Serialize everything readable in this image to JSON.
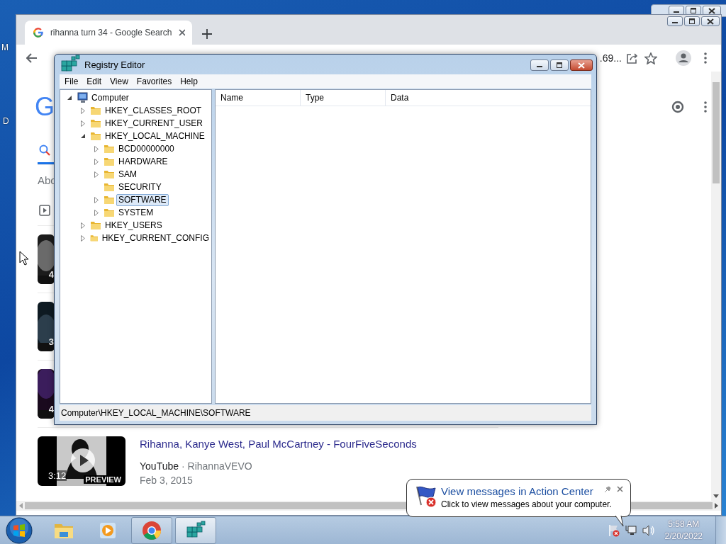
{
  "desktop": {
    "icon_labels": [
      "M",
      "D"
    ]
  },
  "browser": {
    "tab": {
      "title": "rihanna turn 34 - Google Search",
      "selected": true
    },
    "address_fragment": ".69...",
    "page": {
      "logo": "G",
      "about_fragment": "Abo",
      "partial_results": [
        {
          "duration": "4"
        },
        {
          "duration": "3"
        },
        {
          "duration": "4"
        }
      ],
      "result": {
        "duration": "3:12",
        "badge": "PREVIEW",
        "title": "Rihanna, Kanye West, Paul McCartney - FourFiveSeconds",
        "source": "YouTube",
        "channel": "· RihannaVEVO",
        "date": "Feb 3, 2015"
      }
    }
  },
  "registry_editor": {
    "title": "Registry Editor",
    "menu": [
      "File",
      "Edit",
      "View",
      "Favorites",
      "Help"
    ],
    "tree": [
      {
        "label": "Computer",
        "expandable": true,
        "expanded": true,
        "selected": false,
        "children": [
          {
            "label": "HKEY_CLASSES_ROOT",
            "expandable": true,
            "expanded": false,
            "selected": false
          },
          {
            "label": "HKEY_CURRENT_USER",
            "expandable": true,
            "expanded": false,
            "selected": false
          },
          {
            "label": "HKEY_LOCAL_MACHINE",
            "expandable": true,
            "expanded": true,
            "selected": false,
            "children": [
              {
                "label": "BCD00000000",
                "expandable": true,
                "expanded": false,
                "selected": false
              },
              {
                "label": "HARDWARE",
                "expandable": true,
                "expanded": false,
                "selected": false
              },
              {
                "label": "SAM",
                "expandable": true,
                "expanded": false,
                "selected": false
              },
              {
                "label": "SECURITY",
                "expandable": false,
                "selected": false
              },
              {
                "label": "SOFTWARE",
                "expandable": true,
                "expanded": false,
                "selected": true
              },
              {
                "label": "SYSTEM",
                "expandable": true,
                "expanded": false,
                "selected": false
              }
            ]
          },
          {
            "label": "HKEY_USERS",
            "expandable": true,
            "expanded": false,
            "selected": false
          },
          {
            "label": "HKEY_CURRENT_CONFIG",
            "expandable": true,
            "expanded": false,
            "selected": false
          }
        ]
      }
    ],
    "columns": [
      "Name",
      "Type",
      "Data"
    ],
    "status_path": "Computer\\HKEY_LOCAL_MACHINE\\SOFTWARE"
  },
  "notification": {
    "title": "View messages in Action Center",
    "message": "Click to view messages about your computer."
  },
  "taskbar": {
    "items": [
      {
        "kind": "explorer",
        "running": false,
        "selected": false
      },
      {
        "kind": "media-player",
        "running": false,
        "selected": false
      },
      {
        "kind": "chrome",
        "running": true,
        "selected": false
      },
      {
        "kind": "registry",
        "running": true,
        "selected": true
      }
    ],
    "time": "5:58 AM",
    "date": "2/20/2022"
  }
}
